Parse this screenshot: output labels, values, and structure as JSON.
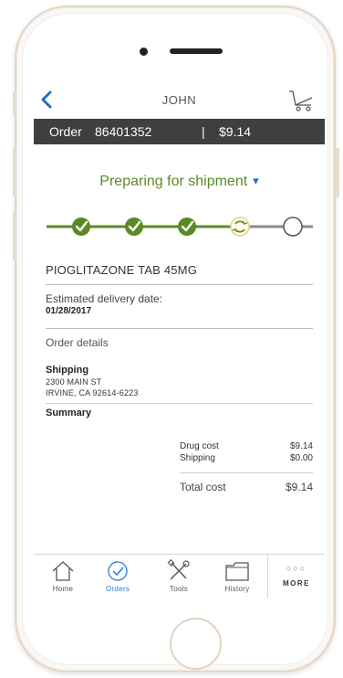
{
  "header": {
    "user_name": "JOHN"
  },
  "order_bar": {
    "label": "Order",
    "number": "86401352",
    "separator": "|",
    "amount": "$9.14"
  },
  "status": {
    "text": "Preparing for shipment",
    "steps_completed": 3,
    "steps_total": 5,
    "current_step": 4
  },
  "drug": {
    "name": "PIOGLITAZONE TAB 45MG"
  },
  "delivery": {
    "label": "Estimated delivery date:",
    "date": "01/28/2017"
  },
  "order_details": {
    "title": "Order details",
    "shipping_heading": "Shipping",
    "address_line1": "2300 MAIN ST",
    "address_line2": "IRVINE, CA 92614-6223",
    "summary_heading": "Summary",
    "drug_cost_label": "Drug cost",
    "drug_cost_value": "$9.14",
    "shipping_label": "Shipping",
    "shipping_value": "$0.00",
    "total_label": "Total cost",
    "total_value": "$9.14"
  },
  "tabs": [
    {
      "label": "Home",
      "icon": "home-icon",
      "active": false
    },
    {
      "label": "Orders",
      "icon": "orders-check-icon",
      "active": true
    },
    {
      "label": "Tools",
      "icon": "tools-icon",
      "active": false
    },
    {
      "label": "History",
      "icon": "folder-icon",
      "active": false
    }
  ],
  "more": {
    "dots": "○○○",
    "label": "MORE"
  },
  "colors": {
    "accent_blue": "#1f6fc5",
    "status_green": "#5a8a26",
    "order_bar_bg": "#3f3f3f"
  }
}
